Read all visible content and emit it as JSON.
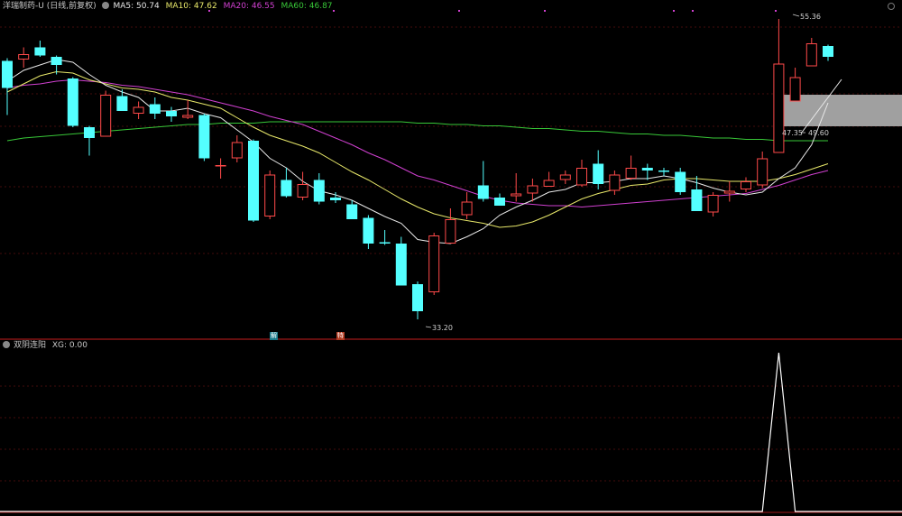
{
  "header": {
    "title": "洋瑞制药-U (日线,前复权)",
    "ma5_label": "MA5: 50.74",
    "ma10_label": "MA10: 47.62",
    "ma20_label": "MA20: 46.55",
    "ma60_label": "MA60: 46.87"
  },
  "indicator": {
    "name": "双阴连阳",
    "value_label": "XG: 0.00"
  },
  "badges": {
    "left": "解",
    "right": "特"
  },
  "colors": {
    "up": "#ff4a4a",
    "down": "#54ffff",
    "ma5": "#e8e8e8",
    "ma10": "#e8e86a",
    "ma20": "#d040d0",
    "ma60": "#38c838",
    "grid": "#5a1010",
    "separator": "#a01818",
    "zone": "#a0a0a0"
  },
  "chart_data": {
    "type": "candlestick",
    "annotations": {
      "high": "55.36",
      "low": "33.20",
      "ma_pair": "47.35",
      "ma_pair2": "49.60"
    },
    "price_ylim": [
      31.8,
      56.8
    ],
    "candles": [
      [
        52.3,
        50.3,
        52.5,
        48.3
      ],
      [
        52.4,
        52.8,
        53.3,
        51.8
      ],
      [
        53.3,
        52.7,
        53.8,
        52.6
      ],
      [
        52.6,
        52.0,
        52.7,
        51.3
      ],
      [
        51.0,
        47.5,
        51.1,
        47.4
      ],
      [
        47.4,
        46.6,
        47.5,
        45.3
      ],
      [
        46.7,
        49.8,
        50.1,
        46.7
      ],
      [
        49.7,
        48.6,
        50.2,
        48.6
      ],
      [
        48.4,
        48.9,
        49.3,
        48.0
      ],
      [
        49.1,
        48.4,
        49.6,
        48.0
      ],
      [
        48.6,
        48.2,
        48.9,
        47.8
      ],
      [
        48.1,
        48.3,
        49.4,
        48.0
      ],
      [
        48.3,
        45.1,
        48.4,
        44.9
      ],
      [
        44.5,
        44.6,
        45.1,
        43.6
      ],
      [
        45.1,
        46.3,
        46.8,
        44.8
      ],
      [
        46.4,
        40.5,
        46.5,
        40.4
      ],
      [
        40.8,
        43.9,
        44.2,
        40.6
      ],
      [
        43.5,
        42.3,
        44.4,
        42.2
      ],
      [
        42.2,
        43.2,
        44.1,
        42.0
      ],
      [
        43.5,
        41.9,
        44.0,
        41.7
      ],
      [
        42.2,
        42.0,
        42.6,
        41.8
      ],
      [
        41.7,
        40.6,
        42.0,
        40.6
      ],
      [
        40.7,
        38.8,
        40.9,
        38.4
      ],
      [
        38.9,
        38.8,
        39.8,
        38.7
      ],
      [
        38.8,
        35.7,
        39.3,
        35.7
      ],
      [
        35.8,
        33.8,
        36.0,
        33.2
      ],
      [
        35.2,
        39.4,
        39.6,
        35.0
      ],
      [
        38.8,
        40.6,
        41.4,
        38.8
      ],
      [
        40.9,
        41.9,
        42.6,
        40.6
      ],
      [
        43.1,
        42.1,
        44.9,
        41.9
      ],
      [
        42.2,
        41.6,
        42.5,
        41.6
      ],
      [
        42.3,
        42.5,
        44.0,
        41.9
      ],
      [
        42.5,
        43.1,
        43.6,
        41.9
      ],
      [
        43.0,
        43.5,
        44.1,
        43.1
      ],
      [
        43.5,
        43.9,
        44.2,
        43.2
      ],
      [
        43.1,
        44.4,
        45.0,
        43.0
      ],
      [
        44.7,
        43.2,
        45.7,
        42.8
      ],
      [
        42.7,
        43.9,
        44.2,
        42.4
      ],
      [
        43.6,
        44.4,
        45.3,
        43.5
      ],
      [
        44.4,
        44.2,
        44.7,
        43.5
      ],
      [
        44.2,
        44.1,
        44.4,
        43.8
      ],
      [
        44.1,
        42.6,
        44.4,
        42.4
      ],
      [
        42.8,
        41.2,
        43.8,
        41.2
      ],
      [
        41.1,
        42.4,
        42.6,
        40.8
      ],
      [
        42.5,
        42.7,
        43.4,
        41.9
      ],
      [
        42.8,
        43.4,
        43.7,
        42.6
      ],
      [
        43.1,
        45.1,
        45.6,
        42.9
      ],
      [
        45.5,
        52.1,
        55.4,
        47.4
      ],
      [
        49.3,
        51.1,
        51.8,
        50.3
      ],
      [
        51.9,
        53.6,
        54.0,
        51.9
      ],
      [
        53.4,
        52.6,
        53.5,
        52.3
      ]
    ],
    "ma5": [
      50.8,
      51.6,
      52.0,
      52.4,
      52.2,
      51.3,
      50.5,
      50.0,
      49.6,
      48.6,
      48.6,
      48.8,
      48.4,
      48.1,
      47.2,
      46.3,
      45.1,
      44.4,
      43.4,
      42.7,
      42.4,
      42.0,
      41.4,
      40.8,
      40.3,
      39.1,
      38.9,
      38.8,
      39.3,
      39.9,
      40.9,
      41.5,
      42.0,
      42.6,
      42.8,
      43.3,
      43.3,
      43.4,
      43.6,
      43.6,
      43.8,
      43.6,
      43.3,
      42.9,
      42.6,
      42.4,
      42.6,
      43.6,
      44.4,
      46.1,
      49.2
    ],
    "ma10": [
      50.0,
      50.6,
      51.2,
      51.5,
      51.4,
      50.9,
      50.6,
      50.3,
      50.2,
      50.0,
      49.6,
      49.4,
      49.1,
      48.8,
      48.1,
      47.4,
      46.8,
      46.4,
      46.0,
      45.5,
      44.8,
      44.1,
      43.5,
      42.8,
      42.1,
      41.5,
      41.0,
      40.7,
      40.5,
      40.3,
      40.0,
      40.1,
      40.4,
      40.9,
      41.5,
      42.1,
      42.5,
      42.8,
      43.1,
      43.2,
      43.5,
      43.6,
      43.6,
      43.5,
      43.4,
      43.4,
      43.4,
      43.6,
      43.9,
      44.3,
      44.7
    ],
    "ma20": [
      50.3,
      50.5,
      50.6,
      50.8,
      50.9,
      50.8,
      50.7,
      50.5,
      50.4,
      50.2,
      50.0,
      49.8,
      49.5,
      49.2,
      48.9,
      48.6,
      48.2,
      47.9,
      47.6,
      47.1,
      46.6,
      46.1,
      45.5,
      45.0,
      44.4,
      43.8,
      43.5,
      43.1,
      42.7,
      42.3,
      42.0,
      41.8,
      41.7,
      41.6,
      41.6,
      41.5,
      41.6,
      41.7,
      41.8,
      41.9,
      42.0,
      42.1,
      42.2,
      42.3,
      42.4,
      42.5,
      42.8,
      43.1,
      43.5,
      43.9,
      44.2
    ],
    "ma60": [
      46.4,
      46.6,
      46.7,
      46.8,
      46.9,
      47.0,
      47.1,
      47.2,
      47.3,
      47.4,
      47.5,
      47.6,
      47.6,
      47.7,
      47.7,
      47.7,
      47.8,
      47.8,
      47.8,
      47.8,
      47.8,
      47.8,
      47.8,
      47.8,
      47.8,
      47.7,
      47.7,
      47.6,
      47.6,
      47.5,
      47.5,
      47.4,
      47.3,
      47.3,
      47.2,
      47.1,
      47.1,
      47.0,
      46.9,
      46.9,
      46.8,
      46.8,
      46.7,
      46.6,
      46.6,
      46.5,
      46.5,
      46.4,
      46.4,
      46.4,
      46.4
    ],
    "xg": [
      0,
      0,
      0,
      0,
      0,
      0,
      0,
      0,
      0,
      0,
      0,
      0,
      0,
      0,
      0,
      0,
      0,
      0,
      0,
      0,
      0,
      0,
      0,
      0,
      0,
      0,
      0,
      0,
      0,
      0,
      0,
      0,
      0,
      0,
      0,
      0,
      0,
      0,
      0,
      0,
      0,
      0,
      0,
      0,
      0,
      0,
      0,
      1,
      0,
      0,
      0
    ]
  }
}
